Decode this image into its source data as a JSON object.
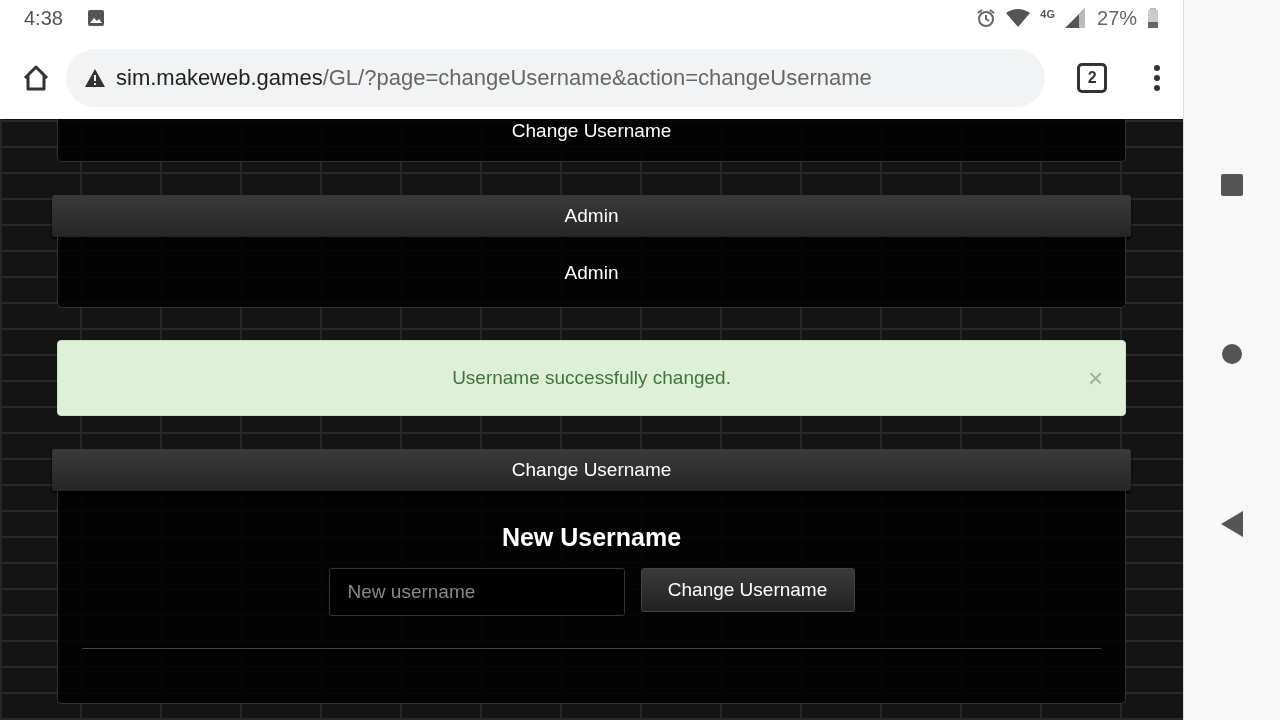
{
  "status_bar": {
    "time": "4:38",
    "network": "4G",
    "battery": "27%"
  },
  "browser": {
    "url_host": "sim.makeweb.games",
    "url_path": "/GL/?page=changeUsername&action=changeUsername",
    "tab_count": "2"
  },
  "panels": [
    {
      "kind": "partial",
      "body": "Change Username"
    },
    {
      "kind": "panel",
      "header": "Admin",
      "body": "Admin"
    }
  ],
  "alert": {
    "message": "Username successfully changed.",
    "close": "×"
  },
  "form_panel": {
    "header": "Change Username",
    "title": "New Username",
    "field": {
      "placeholder": "New username"
    },
    "button": "Change Username"
  }
}
